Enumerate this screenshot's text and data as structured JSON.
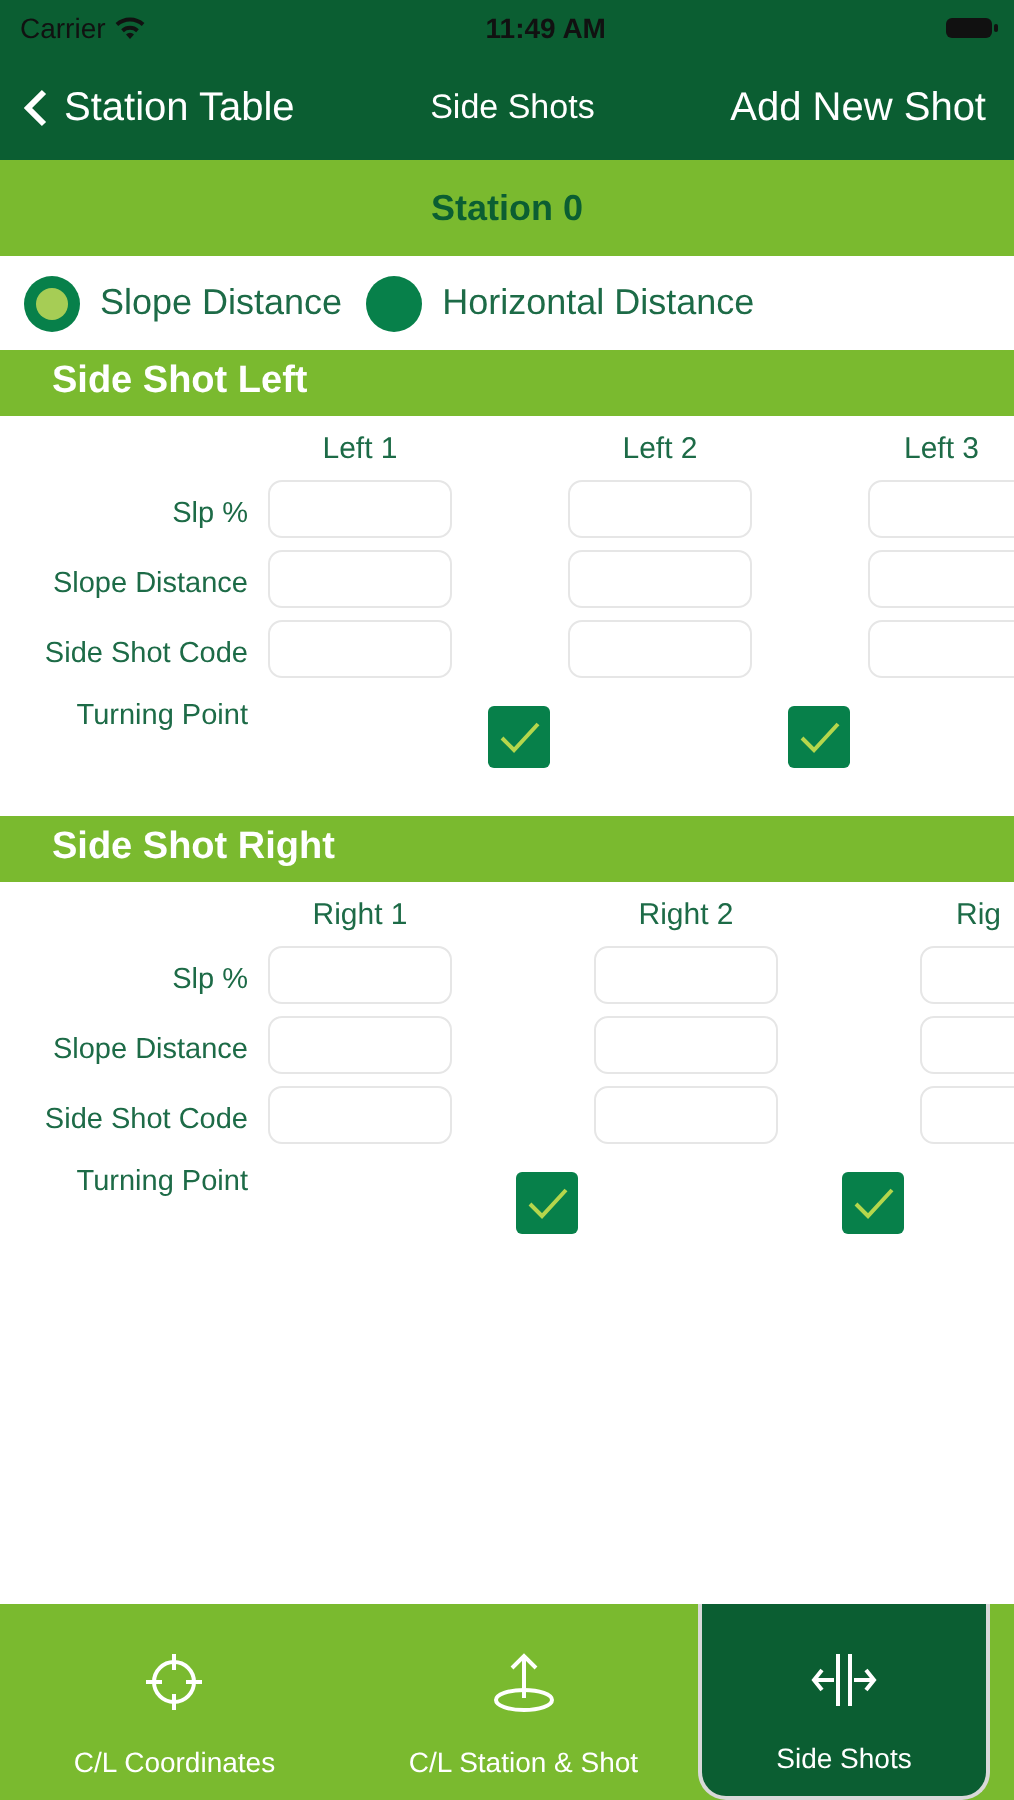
{
  "status_bar": {
    "carrier": "Carrier",
    "time": "11:49 AM"
  },
  "nav": {
    "back_label": "Station Table",
    "title": "Side Shots",
    "action": "Add New Shot"
  },
  "station": "Station 0",
  "distance_modes": [
    {
      "label": "Slope Distance",
      "selected": true
    },
    {
      "label": "Horizontal Distance",
      "selected": false
    }
  ],
  "sections": [
    {
      "title": "Side Shot Left",
      "row_labels": [
        "Slp %",
        "Slope Distance",
        "Side Shot Code"
      ],
      "turning_point_label": "Turning Point",
      "columns": [
        {
          "header": "Left 1",
          "turning_point": true
        },
        {
          "header": "Left 2",
          "turning_point": true
        },
        {
          "header": "Left 3"
        }
      ]
    },
    {
      "title": "Side Shot Right",
      "row_labels": [
        "Slp %",
        "Slope Distance",
        "Side Shot Code"
      ],
      "turning_point_label": "Turning Point",
      "columns": [
        {
          "header": "Right 1",
          "turning_point": true
        },
        {
          "header": "Right 2",
          "turning_point": true
        },
        {
          "header": "Rig"
        }
      ]
    }
  ],
  "tab_bar": [
    {
      "label": "C/L Coordinates",
      "selected": false
    },
    {
      "label": "C/L Station & Shot",
      "selected": false
    },
    {
      "label": "Side Shots",
      "selected": true
    }
  ]
}
